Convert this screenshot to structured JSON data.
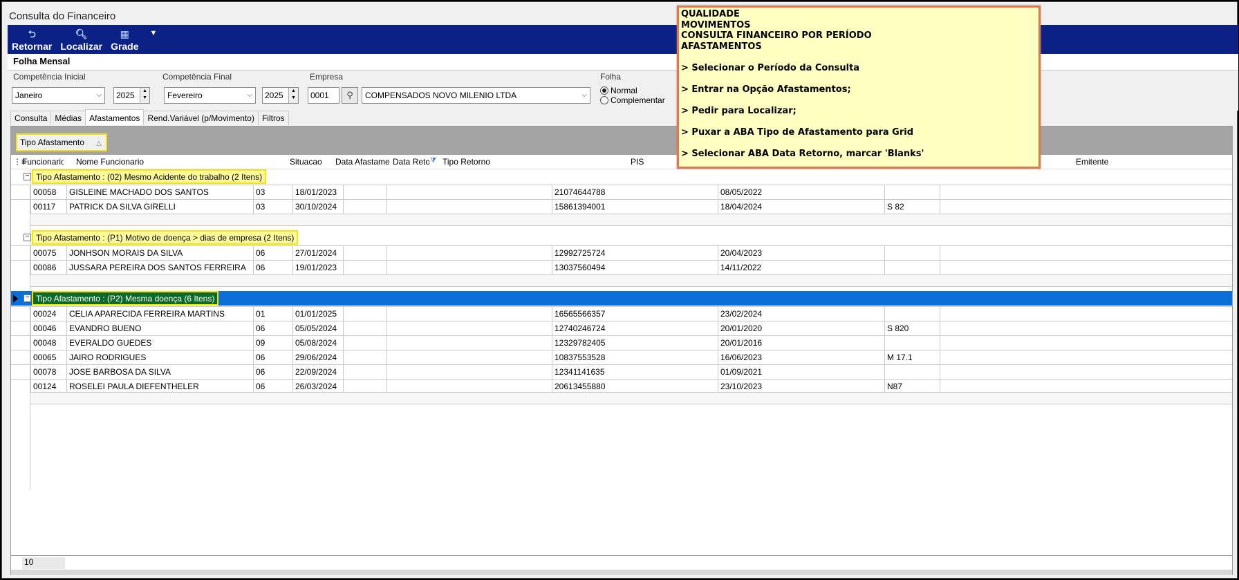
{
  "window": {
    "title": "Consulta do Financeiro"
  },
  "toolbar": {
    "retornar": "Retornar",
    "localizar": "Localizar",
    "grade": "Grade"
  },
  "subtab": "Folha Mensal",
  "filters": {
    "competencia_inicial_label": "Competência Inicial",
    "competencia_inicial_mes": "Janeiro",
    "competencia_inicial_ano": "2025",
    "competencia_final_label": "Competência Final",
    "competencia_final_mes": "Fevereiro",
    "competencia_final_ano": "2025",
    "empresa_label": "Empresa",
    "empresa_codigo": "0001",
    "empresa_nome": "COMPENSADOS NOVO MILENIO LTDA",
    "folha_label": "Folha",
    "folha_normal": "Normal",
    "folha_complementar": "Complementar"
  },
  "tabs": [
    "Consulta",
    "Médias",
    "Afastamentos",
    "Rend.Variável (p/Movimento)",
    "Filtros"
  ],
  "grid": {
    "group_chip": "Tipo Afastamento",
    "headers": {
      "funcionario": "Funcionario",
      "nome": "Nome Funcionario",
      "situacao": "Situacao",
      "data_afast": "Data Afastamento",
      "data_retorno": "Data Retorno",
      "tipo_retorno": "Tipo Retorno",
      "pis": "PIS",
      "emitente": "Emitente"
    },
    "groups": [
      {
        "label": "Tipo Afastamento : (02) Mesmo Acidente do trabalho (2 Itens)",
        "rows": [
          [
            "00058",
            "GISLEINE MACHADO DOS SANTOS",
            "03",
            "18/01/2023",
            "",
            "",
            "21074644788",
            "08/05/2022",
            ""
          ],
          [
            "00117",
            "PATRICK DA SILVA GIRELLI",
            "03",
            "30/10/2024",
            "",
            "",
            "15861394001",
            "18/04/2024",
            "S 82"
          ]
        ]
      },
      {
        "label": "Tipo Afastamento : (P1) Motivo de doença > dias de empresa (2 Itens)",
        "rows": [
          [
            "00075",
            "JONHSON MORAIS DA SILVA",
            "06",
            "27/01/2024",
            "",
            "",
            "12992725724",
            "20/04/2023",
            ""
          ],
          [
            "00086",
            "JUSSARA PEREIRA DOS SANTOS FERREIRA",
            "06",
            "19/01/2023",
            "",
            "",
            "13037560494",
            "14/11/2022",
            ""
          ]
        ]
      },
      {
        "label": "Tipo Afastamento : (P2) Mesma doença (6 Itens)",
        "rows": [
          [
            "00024",
            "CELIA APARECIDA FERREIRA MARTINS",
            "01",
            "01/01/2025",
            "",
            "",
            "16565566357",
            "23/02/2024",
            ""
          ],
          [
            "00046",
            "EVANDRO BUENO",
            "06",
            "05/05/2024",
            "",
            "",
            "12740246724",
            "20/01/2020",
            "S 820"
          ],
          [
            "00048",
            "EVERALDO GUEDES",
            "09",
            "05/08/2024",
            "",
            "",
            "12329782405",
            "20/01/2016",
            ""
          ],
          [
            "00065",
            "JAIRO RODRIGUES",
            "06",
            "29/06/2024",
            "",
            "",
            "10837553528",
            "16/06/2023",
            "M 17.1"
          ],
          [
            "00078",
            "JOSE BARBOSA DA SILVA",
            "06",
            "22/09/2024",
            "",
            "",
            "12341141635",
            "01/09/2021",
            ""
          ],
          [
            "00124",
            "ROSELEI PAULA DIEFENTHELER",
            "06",
            "26/03/2024",
            "",
            "",
            "20613455880",
            "23/10/2023",
            "N87"
          ]
        ]
      }
    ],
    "footer_count": "10"
  },
  "note": {
    "lines": [
      "QUALIDADE",
      "MOVIMENTOS",
      "CONSULTA FINANCEIRO POR PERÍODO",
      "AFASTAMENTOS",
      "",
      "> Selecionar o Período da Consulta",
      "",
      "> Entrar na Opção Afastamentos;",
      "",
      "> Pedir para Localizar;",
      "",
      "> Puxar a ABA Tipo de Afastamento para Grid",
      "",
      "> Selecionar ABA Data Retorno, marcar 'Blanks'"
    ]
  }
}
